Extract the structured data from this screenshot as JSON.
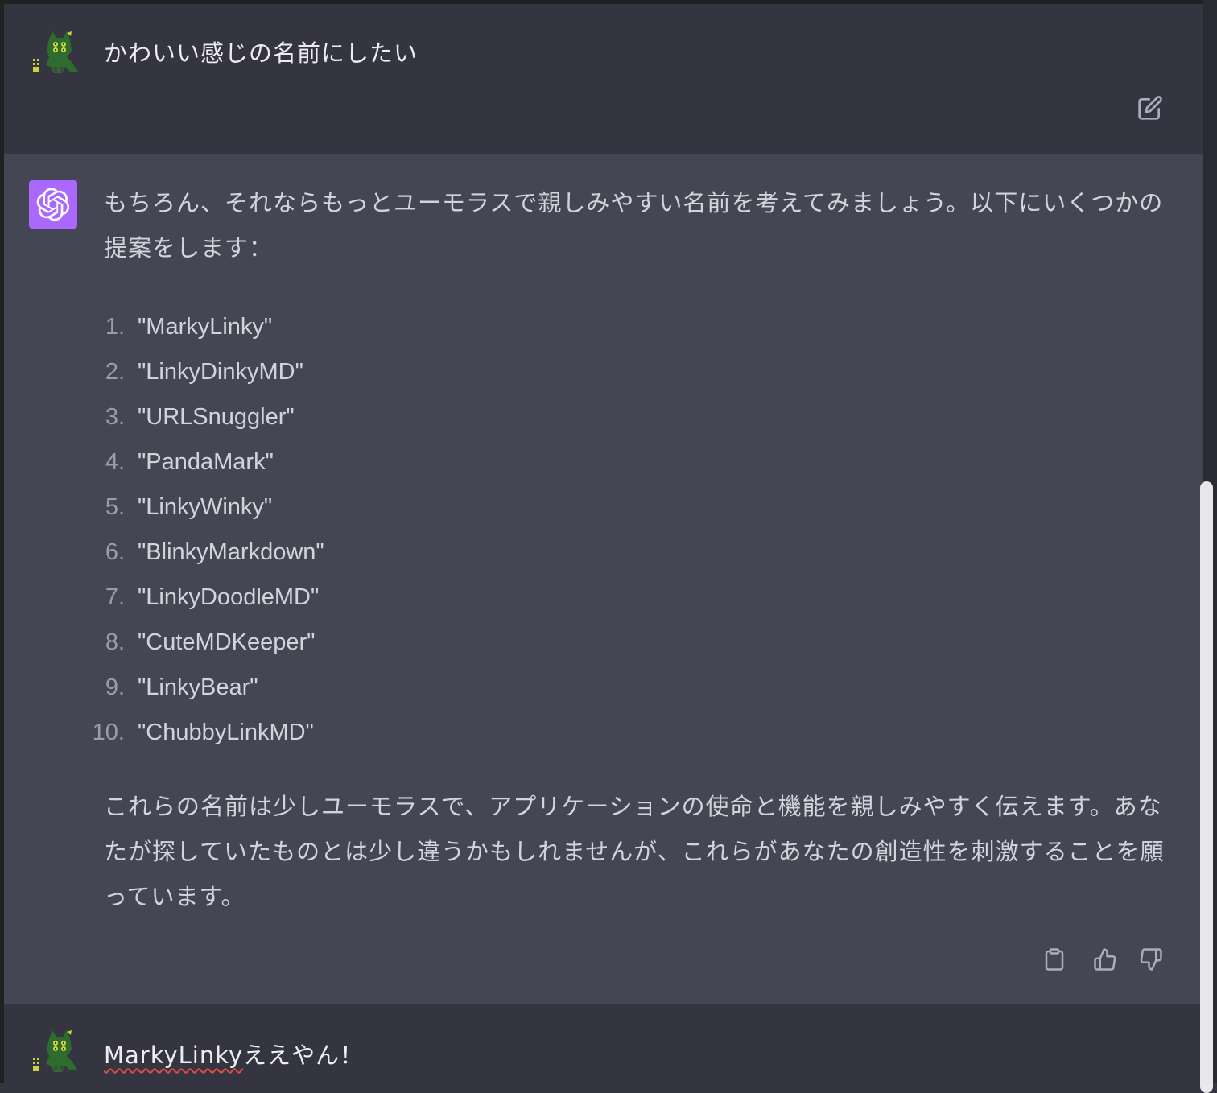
{
  "messages": {
    "user1": {
      "text": "かわいい感じの名前にしたい",
      "avatar": "cat-avatar-icon"
    },
    "assistant": {
      "intro": "もちろん、それならもっとユーモラスで親しみやすい名前を考えてみましょう。以下にいくつかの提案をします：",
      "items": [
        {
          "num": "1.",
          "name": "\"MarkyLinky\""
        },
        {
          "num": "2.",
          "name": "\"LinkyDinkyMD\""
        },
        {
          "num": "3.",
          "name": "\"URLSnuggler\""
        },
        {
          "num": "4.",
          "name": "\"PandaMark\""
        },
        {
          "num": "5.",
          "name": "\"LinkyWinky\""
        },
        {
          "num": "6.",
          "name": "\"BlinkyMarkdown\""
        },
        {
          "num": "7.",
          "name": "\"LinkyDoodleMD\""
        },
        {
          "num": "8.",
          "name": "\"CuteMDKeeper\""
        },
        {
          "num": "9.",
          "name": "\"LinkyBear\""
        },
        {
          "num": "10.",
          "name": "\"ChubbyLinkMD\""
        }
      ],
      "closing": "これらの名前は少しユーモラスで、アプリケーションの使命と機能を親しみやすく伝えます。あなたが探していたものとは少し違うかもしれませんが、これらがあなたの創造性を刺激することを願っています。"
    },
    "user2": {
      "text_marked": "MarkyLinky",
      "text_rest": "ええやん！"
    }
  },
  "icons": {
    "edit": "edit-icon",
    "copy": "clipboard-icon",
    "thumbs_up": "thumbs-up-icon",
    "thumbs_down": "thumbs-down-icon",
    "assistant_logo": "openai-logo-icon"
  },
  "colors": {
    "background": "#343541",
    "assistant_background": "#444654",
    "assistant_avatar": "#ab68ff",
    "text": "#ececf1",
    "spellcheck": "#e04b4b"
  }
}
